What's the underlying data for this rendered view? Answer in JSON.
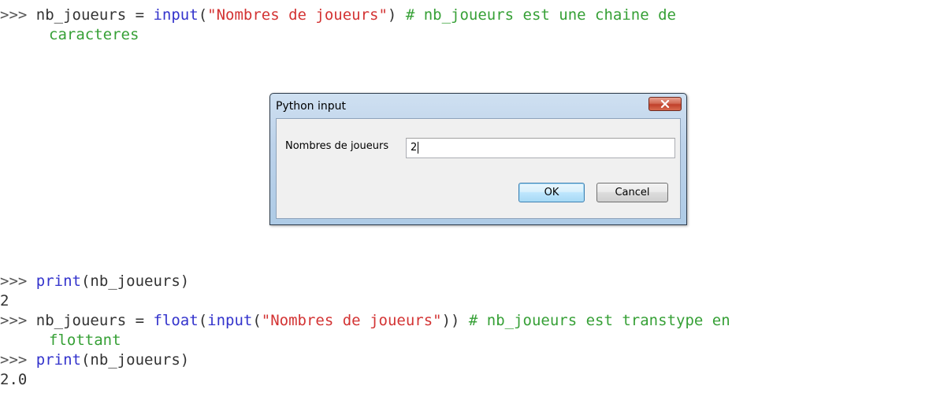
{
  "console": {
    "top_lines": [
      {
        "prompt": ">>> ",
        "var": "nb_joueurs",
        "assign": " = ",
        "func": "input",
        "open": "(",
        "string": "\"Nombres de joueurs\"",
        "close": ")",
        "comment": " # nb_joueurs est une chaine de"
      },
      {
        "continuation": "caracteres"
      }
    ],
    "bottom_lines": {
      "l1": {
        "prompt": ">>> ",
        "func": "print",
        "args": "(nb_joueurs)"
      },
      "l2": {
        "output": "2"
      },
      "l3": {
        "prompt": ">>> ",
        "var": "nb_joueurs",
        "assign": " = ",
        "func1": "float",
        "open1": "(",
        "func2": "input",
        "open2": "(",
        "string": "\"Nombres de joueurs\"",
        "close": "))",
        "comment": " # nb_joueurs est transtype en"
      },
      "l4": {
        "continuation": "flottant"
      },
      "l5": {
        "prompt": ">>> ",
        "func": "print",
        "args": "(nb_joueurs)"
      },
      "l6": {
        "output": "2.0"
      }
    }
  },
  "dialog": {
    "title": "Python input",
    "close_icon": "close-x-icon",
    "prompt_label": "Nombres de joueurs",
    "input_value": "2",
    "ok_label": "OK",
    "cancel_label": "Cancel"
  },
  "colors": {
    "builtin": "#3333cc",
    "string": "#d33333",
    "comment": "#36a036",
    "text": "#333333"
  }
}
